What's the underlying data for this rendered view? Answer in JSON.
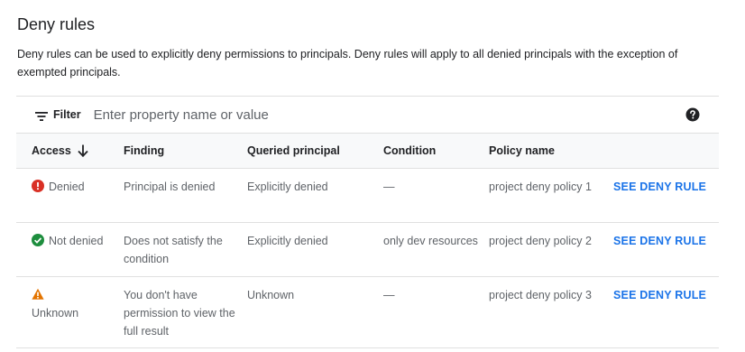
{
  "title": "Deny rules",
  "description": "Deny rules can be used to explicitly deny permissions to principals. Deny rules will apply to all denied principals with the exception of exempted principals.",
  "filter": {
    "label": "Filter",
    "placeholder": "Enter property name or value",
    "icon": "filter-list-icon",
    "help_icon": "help-circle-icon"
  },
  "table": {
    "headers": {
      "access": "Access",
      "finding": "Finding",
      "queried_principal": "Queried principal",
      "condition": "Condition",
      "policy_name": "Policy name"
    },
    "sort_icon": "arrow-down-icon",
    "rows": [
      {
        "status_icon": "error-icon",
        "status_color": "#d93025",
        "access": "Denied",
        "finding": "Principal is denied",
        "queried_principal": "Explicitly denied",
        "condition": "—",
        "policy_name": "project deny policy 1",
        "action": "SEE DENY RULE"
      },
      {
        "status_icon": "check-circle-icon",
        "status_color": "#1e8e3e",
        "access": "Not denied",
        "finding": "Does not satisfy the condition",
        "queried_principal": "Explicitly denied",
        "condition": "only dev resources",
        "policy_name": "project deny policy 2",
        "action": "SEE DENY RULE"
      },
      {
        "status_icon": "warning-icon",
        "status_color": "#e37400",
        "access": "Unknown",
        "finding": "You don't have permission to view the full result",
        "queried_principal": "Unknown",
        "condition": "—",
        "policy_name": "project deny policy 3",
        "action": "SEE DENY RULE"
      }
    ]
  },
  "colors": {
    "link": "#1a73e8",
    "header_bg": "#f8f9fa",
    "border": "#e0e0e0"
  }
}
